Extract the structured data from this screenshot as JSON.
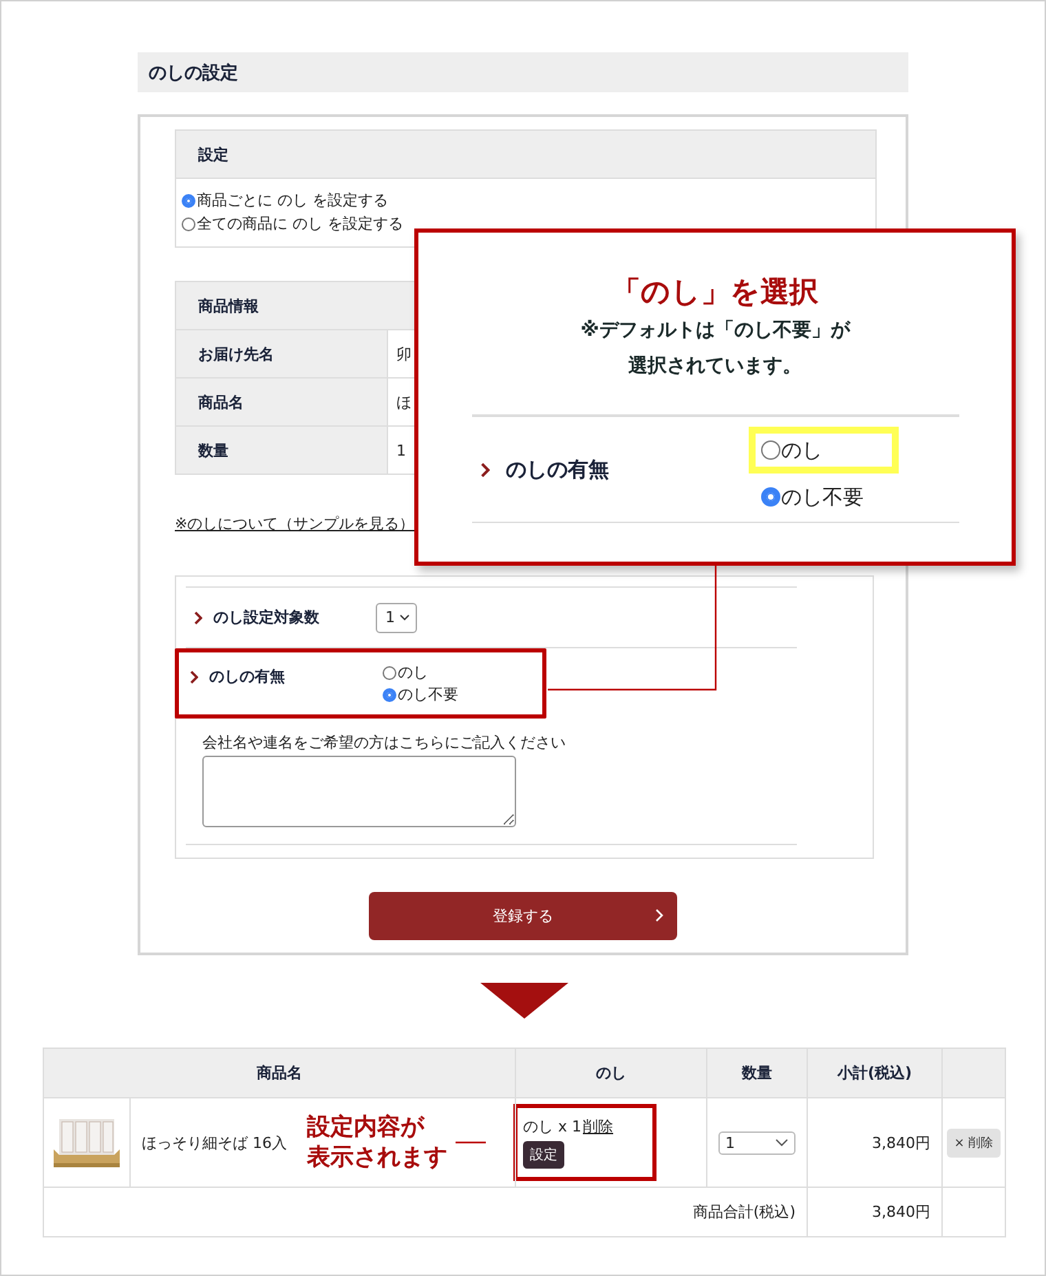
{
  "section_title": "のしの設定",
  "settings": {
    "header": "設定",
    "options": [
      {
        "label": "商品ごとに のし を設定する",
        "selected": true
      },
      {
        "label": "全ての商品に のし を設定する",
        "selected": false
      }
    ]
  },
  "product_info": {
    "header": "商品情報",
    "rows": [
      {
        "label": "お届け先名",
        "value": "卯"
      },
      {
        "label": "商品名",
        "value": "ほ"
      },
      {
        "label": "数量",
        "value": "1"
      }
    ]
  },
  "sample_link": "※のしについて（サンプルを見る）",
  "noshi_form": {
    "count_label": "のし設定対象数",
    "count_value": "1",
    "presence_label": "のしの有無",
    "presence_options": [
      {
        "label": "のし",
        "selected": false
      },
      {
        "label": "のし不要",
        "selected": true
      }
    ],
    "note_label": "会社名や連名をご希望の方はこちらにご記入ください"
  },
  "submit_button": "登録する",
  "callout": {
    "title": "「のし」を選択",
    "note_lines": [
      "※デフォルトは「のし不要」が",
      "選択されています。"
    ],
    "label": "のしの有無",
    "options": [
      {
        "label": "のし",
        "selected": false,
        "highlighted": true
      },
      {
        "label": "のし不要",
        "selected": true,
        "highlighted": false
      }
    ]
  },
  "cart": {
    "columns": [
      "商品名",
      "のし",
      "数量",
      "小計(税込)"
    ],
    "rows": [
      {
        "kind": "picture",
        "name": "ほっそり細そば 16入",
        "noshi": "のし x 1",
        "noshi_delete": "削除",
        "noshi_button": "設定",
        "quantity": "1",
        "subtotal": "3,840円",
        "delete_button": "× 削除"
      }
    ],
    "total_label": "商品合計(税込)",
    "total": "3,840円"
  },
  "annotation_lines": [
    "設定内容が",
    "表示されます"
  ]
}
